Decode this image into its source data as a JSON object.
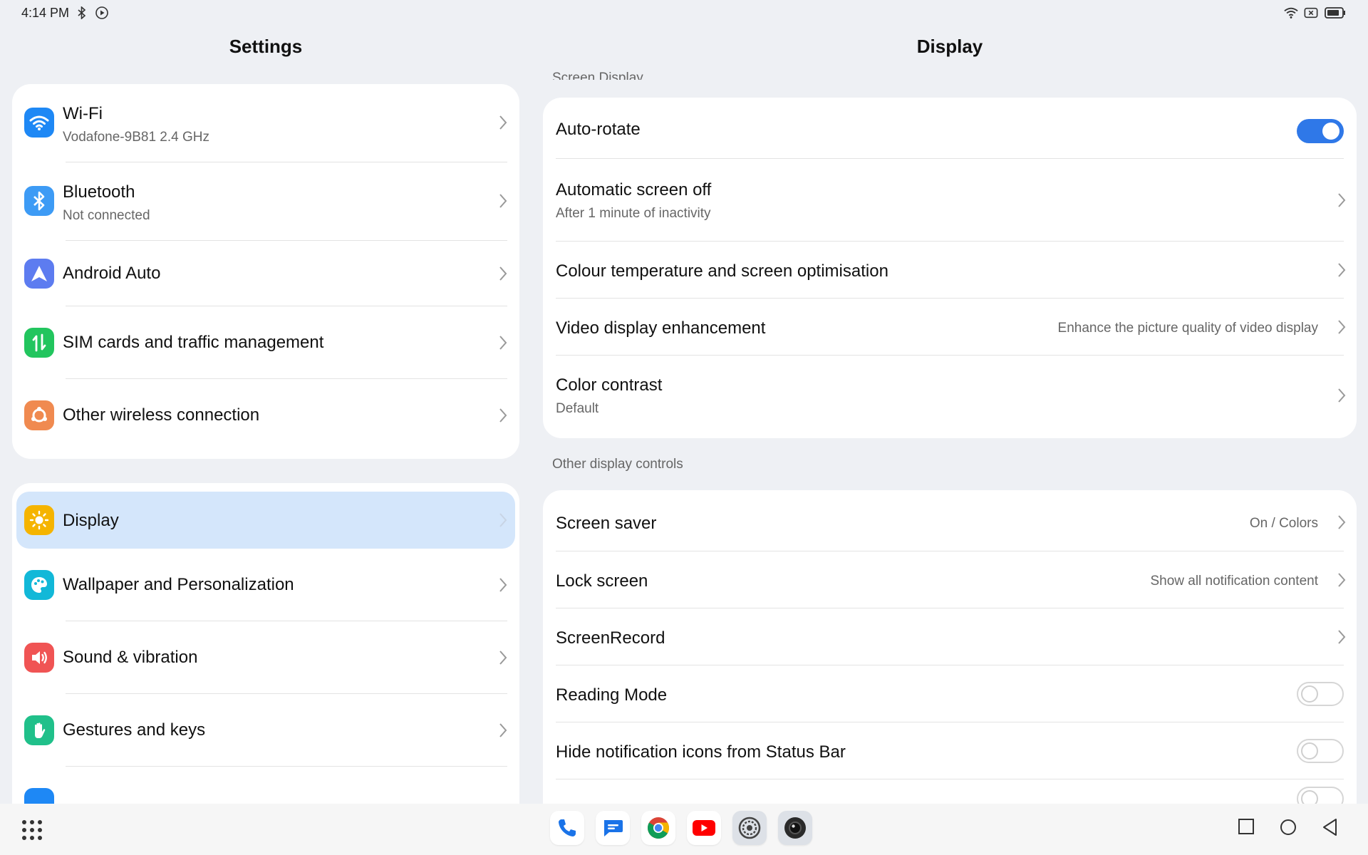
{
  "status_bar": {
    "time": "4:14 PM"
  },
  "left": {
    "title": "Settings",
    "group1": [
      {
        "title": "Wi-Fi",
        "subtitle": "Vodafone-9B81 2.4 GHz",
        "icon": "wifi-icon",
        "color": "#1e88f5"
      },
      {
        "title": "Bluetooth",
        "subtitle": "Not connected",
        "icon": "bluetooth-icon",
        "color": "#3d9bf5"
      },
      {
        "title": "Android Auto",
        "subtitle": "",
        "icon": "android-auto-icon",
        "color": "#5d7cf0"
      },
      {
        "title": "SIM cards and traffic management",
        "subtitle": "",
        "icon": "sim-icon",
        "color": "#22c55e"
      },
      {
        "title": "Other wireless connection",
        "subtitle": "",
        "icon": "wireless-icon",
        "color": "#f08a50"
      }
    ],
    "group2": [
      {
        "title": "Display",
        "icon": "display-icon",
        "color": "#f5b400",
        "selected": true
      },
      {
        "title": "Wallpaper and Personalization",
        "icon": "palette-icon",
        "color": "#12b8d8"
      },
      {
        "title": "Sound & vibration",
        "icon": "sound-icon",
        "color": "#f05454"
      },
      {
        "title": "Gestures and keys",
        "icon": "gesture-icon",
        "color": "#20c08a"
      }
    ]
  },
  "right": {
    "title": "Display",
    "section1_label": "Screen Display",
    "section2_label": "Other display controls",
    "group1": [
      {
        "title": "Auto-rotate",
        "control": "toggle",
        "on": true
      },
      {
        "title": "Automatic screen off",
        "subtitle": "After 1 minute of inactivity",
        "control": "chevron"
      },
      {
        "title": "Colour temperature and screen optimisation",
        "control": "chevron"
      },
      {
        "title": "Video display enhancement",
        "value": "Enhance the picture quality of video display",
        "control": "chevron"
      },
      {
        "title": "Color contrast",
        "subtitle": "Default",
        "control": "chevron"
      }
    ],
    "group2": [
      {
        "title": "Screen saver",
        "value": "On / Colors",
        "control": "chevron"
      },
      {
        "title": "Lock screen",
        "value": "Show all notification content",
        "control": "chevron"
      },
      {
        "title": "ScreenRecord",
        "control": "chevron"
      },
      {
        "title": "Reading Mode",
        "control": "toggle",
        "on": false
      },
      {
        "title": "Hide notification icons from Status Bar",
        "control": "toggle",
        "on": false
      }
    ]
  },
  "colors": {
    "accent": "#2f78e8",
    "selected_bg": "#d4e6fb"
  },
  "dock": [
    "phone-icon",
    "messages-icon",
    "chrome-icon",
    "youtube-icon",
    "settings-icon",
    "camera-icon"
  ]
}
